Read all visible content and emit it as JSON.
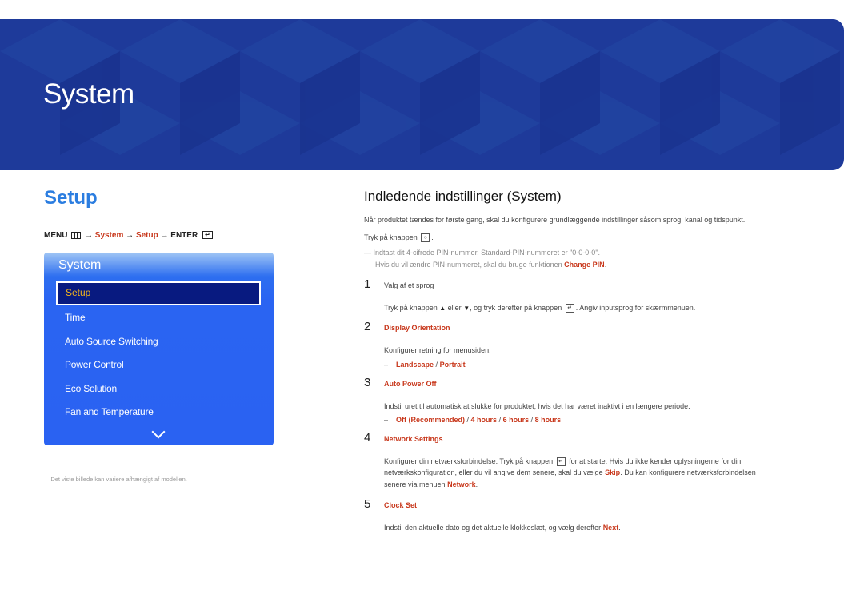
{
  "banner": {
    "title": "System"
  },
  "section_title": "Setup",
  "menu_path": {
    "menu_label": "MENU",
    "menu_icon": "menu-grid-icon",
    "arrow": "→",
    "system": "System",
    "setup": "Setup",
    "enter_label": "ENTER",
    "enter_icon": "enter-icon"
  },
  "osd": {
    "title": "System",
    "selected": "Setup",
    "items": [
      "Time",
      "Auto Source Switching",
      "Power Control",
      "Eco Solution",
      "Fan and Temperature"
    ],
    "more_icon": "chevron-down-icon"
  },
  "footnote": "Det viste billede kan variere afhængigt af modellen.",
  "main": {
    "heading": "Indledende indstillinger (System)",
    "intro": "Når produktet tændes for første gang, skal du konfigurere grundlæggende indstillinger såsom sprog, kanal og tidspunkt.",
    "press_text": "Tryk på knappen",
    "press_icon": "power-button-icon",
    "note_line1": "Indtast dit 4-cifrede PIN-nummer. Standard-PIN-nummeret er \"0-0-0-0\".",
    "note_line2_prefix": "Hvis du vil ændre PIN-nummeret, skal du bruge funktionen",
    "note_line2_link": "Change PIN",
    "steps": [
      {
        "number": "1",
        "title": "Valg af et sprog",
        "desc_prefix": "Tryk på knappen",
        "desc_or": "eller",
        "desc_mid": ", og tryk derefter på knappen",
        "desc_suffix": ". Angiv inputsprog for skærmmenuen."
      },
      {
        "number": "2",
        "title": "Display Orientation",
        "desc": "Konfigurer retning for menusiden.",
        "options": [
          "Landscape",
          "Portrait"
        ]
      },
      {
        "number": "3",
        "title": "Auto Power Off",
        "desc": "Indstil uret til automatisk at slukke for produktet, hvis det har været inaktivt i en længere periode.",
        "options": [
          "Off (Recommended)",
          "4 hours",
          "6 hours",
          "8 hours"
        ]
      },
      {
        "number": "4",
        "title": "Network Settings",
        "desc_l1_prefix": "Konfigurer din netværksforbindelse. Tryk på knappen",
        "desc_l1_suffix": "for at starte. Hvis du ikke kender oplysningerne for din",
        "desc_l2_prefix": "netværkskonfiguration, eller du vil angive dem senere, skal du vælge",
        "desc_l2_link": "Skip",
        "desc_l2_suffix": ". Du kan konfigurere netværksforbindelsen",
        "desc_l3_prefix": "senere via menuen",
        "desc_l3_link": "Network"
      },
      {
        "number": "5",
        "title": "Clock Set",
        "desc_prefix": "Indstil den aktuelle dato og det aktuelle klokkeslæt, og vælg derefter",
        "desc_link": "Next"
      }
    ]
  },
  "colors": {
    "banner": "#1e3a9a",
    "accent_blue": "#2b7de0",
    "accent_red": "#c8381c",
    "osd_blue": "#2a62f2",
    "osd_selected": "#081a80",
    "osd_selected_text": "#f2b21d"
  }
}
